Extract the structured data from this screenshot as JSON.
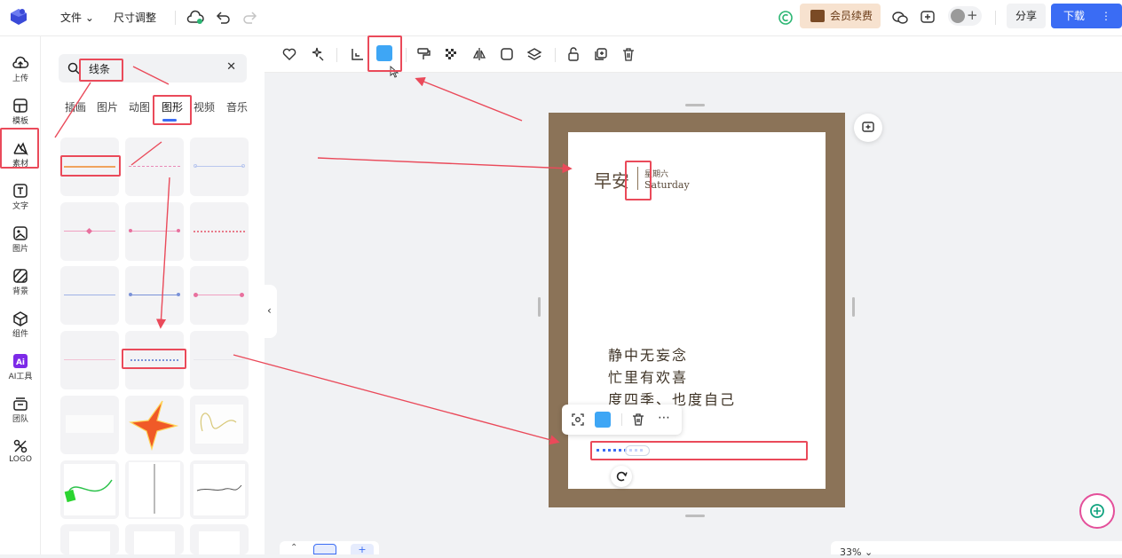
{
  "topbar": {
    "menu_file": "文件 ⌄",
    "menu_resize": "尺寸调整",
    "vip_label": "会员续费",
    "share_label": "分享",
    "download_label": "下载",
    "download_more": "⋮"
  },
  "nav": {
    "items": [
      {
        "label": "上传",
        "icon": "upload-icon"
      },
      {
        "label": "模板",
        "icon": "template-icon"
      },
      {
        "label": "素材",
        "icon": "material-icon"
      },
      {
        "label": "文字",
        "icon": "text-icon"
      },
      {
        "label": "图片",
        "icon": "image-icon"
      },
      {
        "label": "背景",
        "icon": "background-icon"
      },
      {
        "label": "组件",
        "icon": "component-icon"
      },
      {
        "label": "AI工具",
        "icon": "ai-icon"
      },
      {
        "label": "团队",
        "icon": "team-icon"
      },
      {
        "label": "LOGO",
        "icon": "logo-icon"
      }
    ]
  },
  "panel": {
    "search_value": "线条",
    "clear": "✕",
    "tabs": [
      "插画",
      "图片",
      "动图",
      "图形",
      "视频",
      "音乐"
    ],
    "active_tab": "图形"
  },
  "canvas": {
    "hello": "早安",
    "week": "星期六",
    "saturday": "Saturday",
    "poem": [
      "静中无妄念",
      "忙里有欢喜",
      "度四季、也度自己"
    ],
    "zoom": "33% ⌄"
  },
  "colors": {
    "accent": "#3a6cf4",
    "selected_fill": "#3ea6f5",
    "frame": "#8b7358",
    "annotation": "#ea4a5a",
    "vip_bg": "#f7e2cf"
  }
}
